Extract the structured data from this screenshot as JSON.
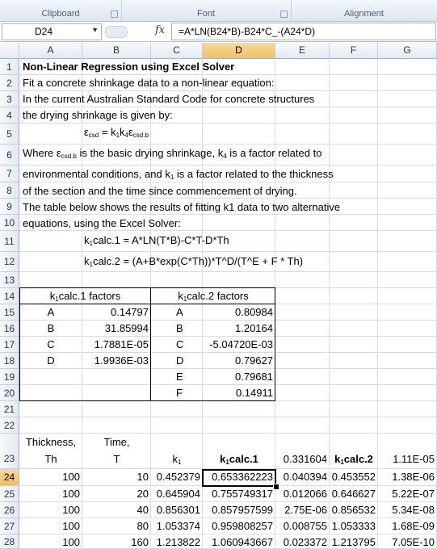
{
  "ribbon": {
    "groups": [
      "Clipboard",
      "Font",
      "Alignment"
    ]
  },
  "formula_bar": {
    "name_box": "D24",
    "fx": "fx",
    "formula": "=A*LN(B24*B)-B24*C_-(A24*D)"
  },
  "columns": [
    "A",
    "B",
    "C",
    "D",
    "E",
    "F",
    "G"
  ],
  "rows": [
    "1",
    "2",
    "3",
    "4",
    "5",
    "6",
    "7",
    "8",
    "9",
    "10",
    "11",
    "12",
    "13",
    "14",
    "15",
    "16",
    "17",
    "18",
    "19",
    "20",
    "21",
    "22",
    "23",
    "24",
    "25",
    "26",
    "27",
    "28"
  ],
  "text": {
    "title": "Non-Linear Regression using Excel Solver",
    "line2": "Fit a concrete shrinkage data to a non-linear equation:",
    "line3": "In the current Australian Standard Code for concrete structures",
    "line4": "the drying shrinkage is given by:",
    "eq5_pre": "ε",
    "eq5_s1": "csd",
    "eq5_mid": " = k",
    "eq5_s2": "1",
    "eq5_k": "k",
    "eq5_s3": "4",
    "eq5_e": "ε",
    "eq5_s4": "csd.b",
    "l6_a": "Where ε",
    "l6_s1": "csd.b",
    "l6_b": " is the basic drying shrinkage, k",
    "l6_s2": "4",
    "l6_c": " is a factor related to",
    "l7_a": "environmental conditions, and k",
    "l7_s": "1",
    "l7_b": " is a factor related to the thickness",
    "line8": "of the section and the time since commencement of drying.",
    "line9": "The table below shows the results of fitting k1 data to two alternative",
    "line10": "equations, using the Excel Solver:",
    "eq11_k": "k",
    "eq11_s": "1",
    "eq11_rest": "calc.1 = A*LN(T*B)-C*T-D*Th",
    "eq12_k": "k",
    "eq12_s": "1",
    "eq12_rest": "calc.2 = (A+B*exp(C*Th))*T^D/(T^E + F * Th)"
  },
  "factors1": {
    "head_k": "k",
    "head_s": "1",
    "head_rest": "calc.1 factors",
    "rows": [
      {
        "name": "A",
        "value": "0.14797"
      },
      {
        "name": "B",
        "value": "31.85994"
      },
      {
        "name": "C",
        "value": "1.7881E-05"
      },
      {
        "name": "D",
        "value": "1.9936E-03"
      }
    ]
  },
  "factors2": {
    "head_k": "k",
    "head_s": "1",
    "head_rest": "calc.2 factors",
    "rows": [
      {
        "name": "A",
        "value": "0.80984"
      },
      {
        "name": "B",
        "value": "1.20164"
      },
      {
        "name": "C",
        "value": "-5.04720E-03"
      },
      {
        "name": "D",
        "value": "0.79627"
      },
      {
        "name": "E",
        "value": "0.79681"
      },
      {
        "name": "F",
        "value": "0.14911"
      }
    ]
  },
  "data_table": {
    "h22": {
      "A": "Thickness,",
      "B": "Time,"
    },
    "h23": {
      "A": "Th",
      "B": "T",
      "C_k": "k",
      "C_s": "1",
      "D_k": "k",
      "D_s": "1",
      "D_rest": "calc.1",
      "E": "0.331604",
      "F_k": "k",
      "F_s": "1",
      "F_rest": "calc.2",
      "G": "1.11E-05"
    },
    "rows": [
      {
        "A": "100",
        "B": "10",
        "C": "0.452379",
        "D": "0.653362223",
        "E": "0.040394",
        "F": "0.453552",
        "G": "1.38E-06"
      },
      {
        "A": "100",
        "B": "20",
        "C": "0.645904",
        "D": "0.755749317",
        "E": "0.012066",
        "F": "0.646627",
        "G": "5.22E-07"
      },
      {
        "A": "100",
        "B": "40",
        "C": "0.856301",
        "D": "0.857957599",
        "E": "2.75E-06",
        "F": "0.856532",
        "G": "5.34E-08"
      },
      {
        "A": "100",
        "B": "80",
        "C": "1.053374",
        "D": "0.959808257",
        "E": "0.008755",
        "F": "1.053333",
        "G": "1.68E-09"
      },
      {
        "A": "100",
        "B": "160",
        "C": "1.213822",
        "D": "1.060943667",
        "E": "0.023372",
        "F": "1.213795",
        "G": "7.05E-10"
      }
    ]
  }
}
